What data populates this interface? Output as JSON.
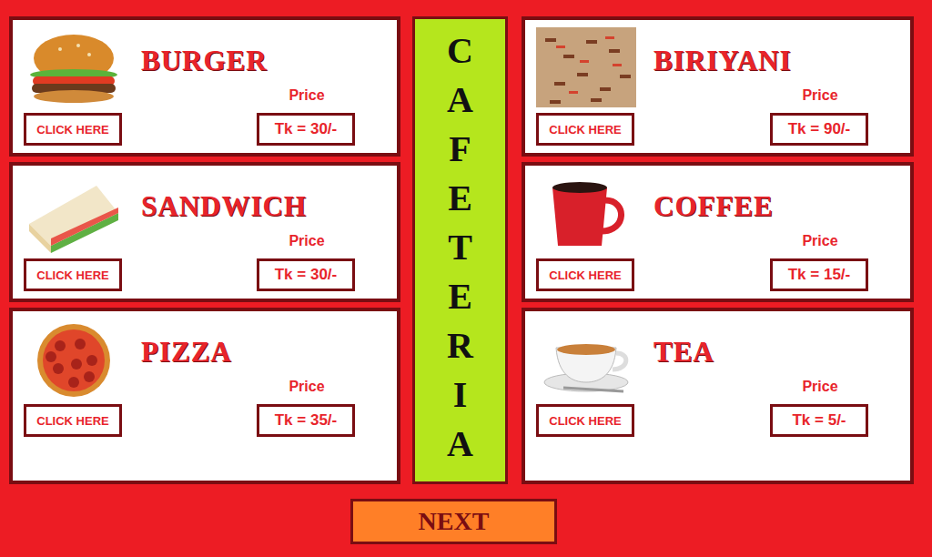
{
  "title": "CAFETERIA",
  "left_items": [
    {
      "name": "BURGER",
      "kind": "burger",
      "price_label": "Price",
      "button": "CLICK HERE",
      "price": "Tk = 30/-"
    },
    {
      "name": "SANDWICH",
      "kind": "sandwich",
      "price_label": "Price",
      "button": "CLICK HERE",
      "price": "Tk = 30/-"
    },
    {
      "name": "PIZZA",
      "kind": "pizza",
      "price_label": "Price",
      "button": "CLICK HERE",
      "price": "Tk = 35/-"
    }
  ],
  "right_items": [
    {
      "name": "BIRIYANI",
      "kind": "biriyani",
      "price_label": "Price",
      "button": "CLICK HERE",
      "price": "Tk = 90/-"
    },
    {
      "name": "COFFEE",
      "kind": "coffee",
      "price_label": "Price",
      "button": "CLICK HERE",
      "price": "Tk = 15/-"
    },
    {
      "name": "TEA",
      "kind": "tea",
      "price_label": "Price",
      "button": "CLICK HERE",
      "price": "Tk = 5/-"
    }
  ],
  "next_button": "NEXT"
}
